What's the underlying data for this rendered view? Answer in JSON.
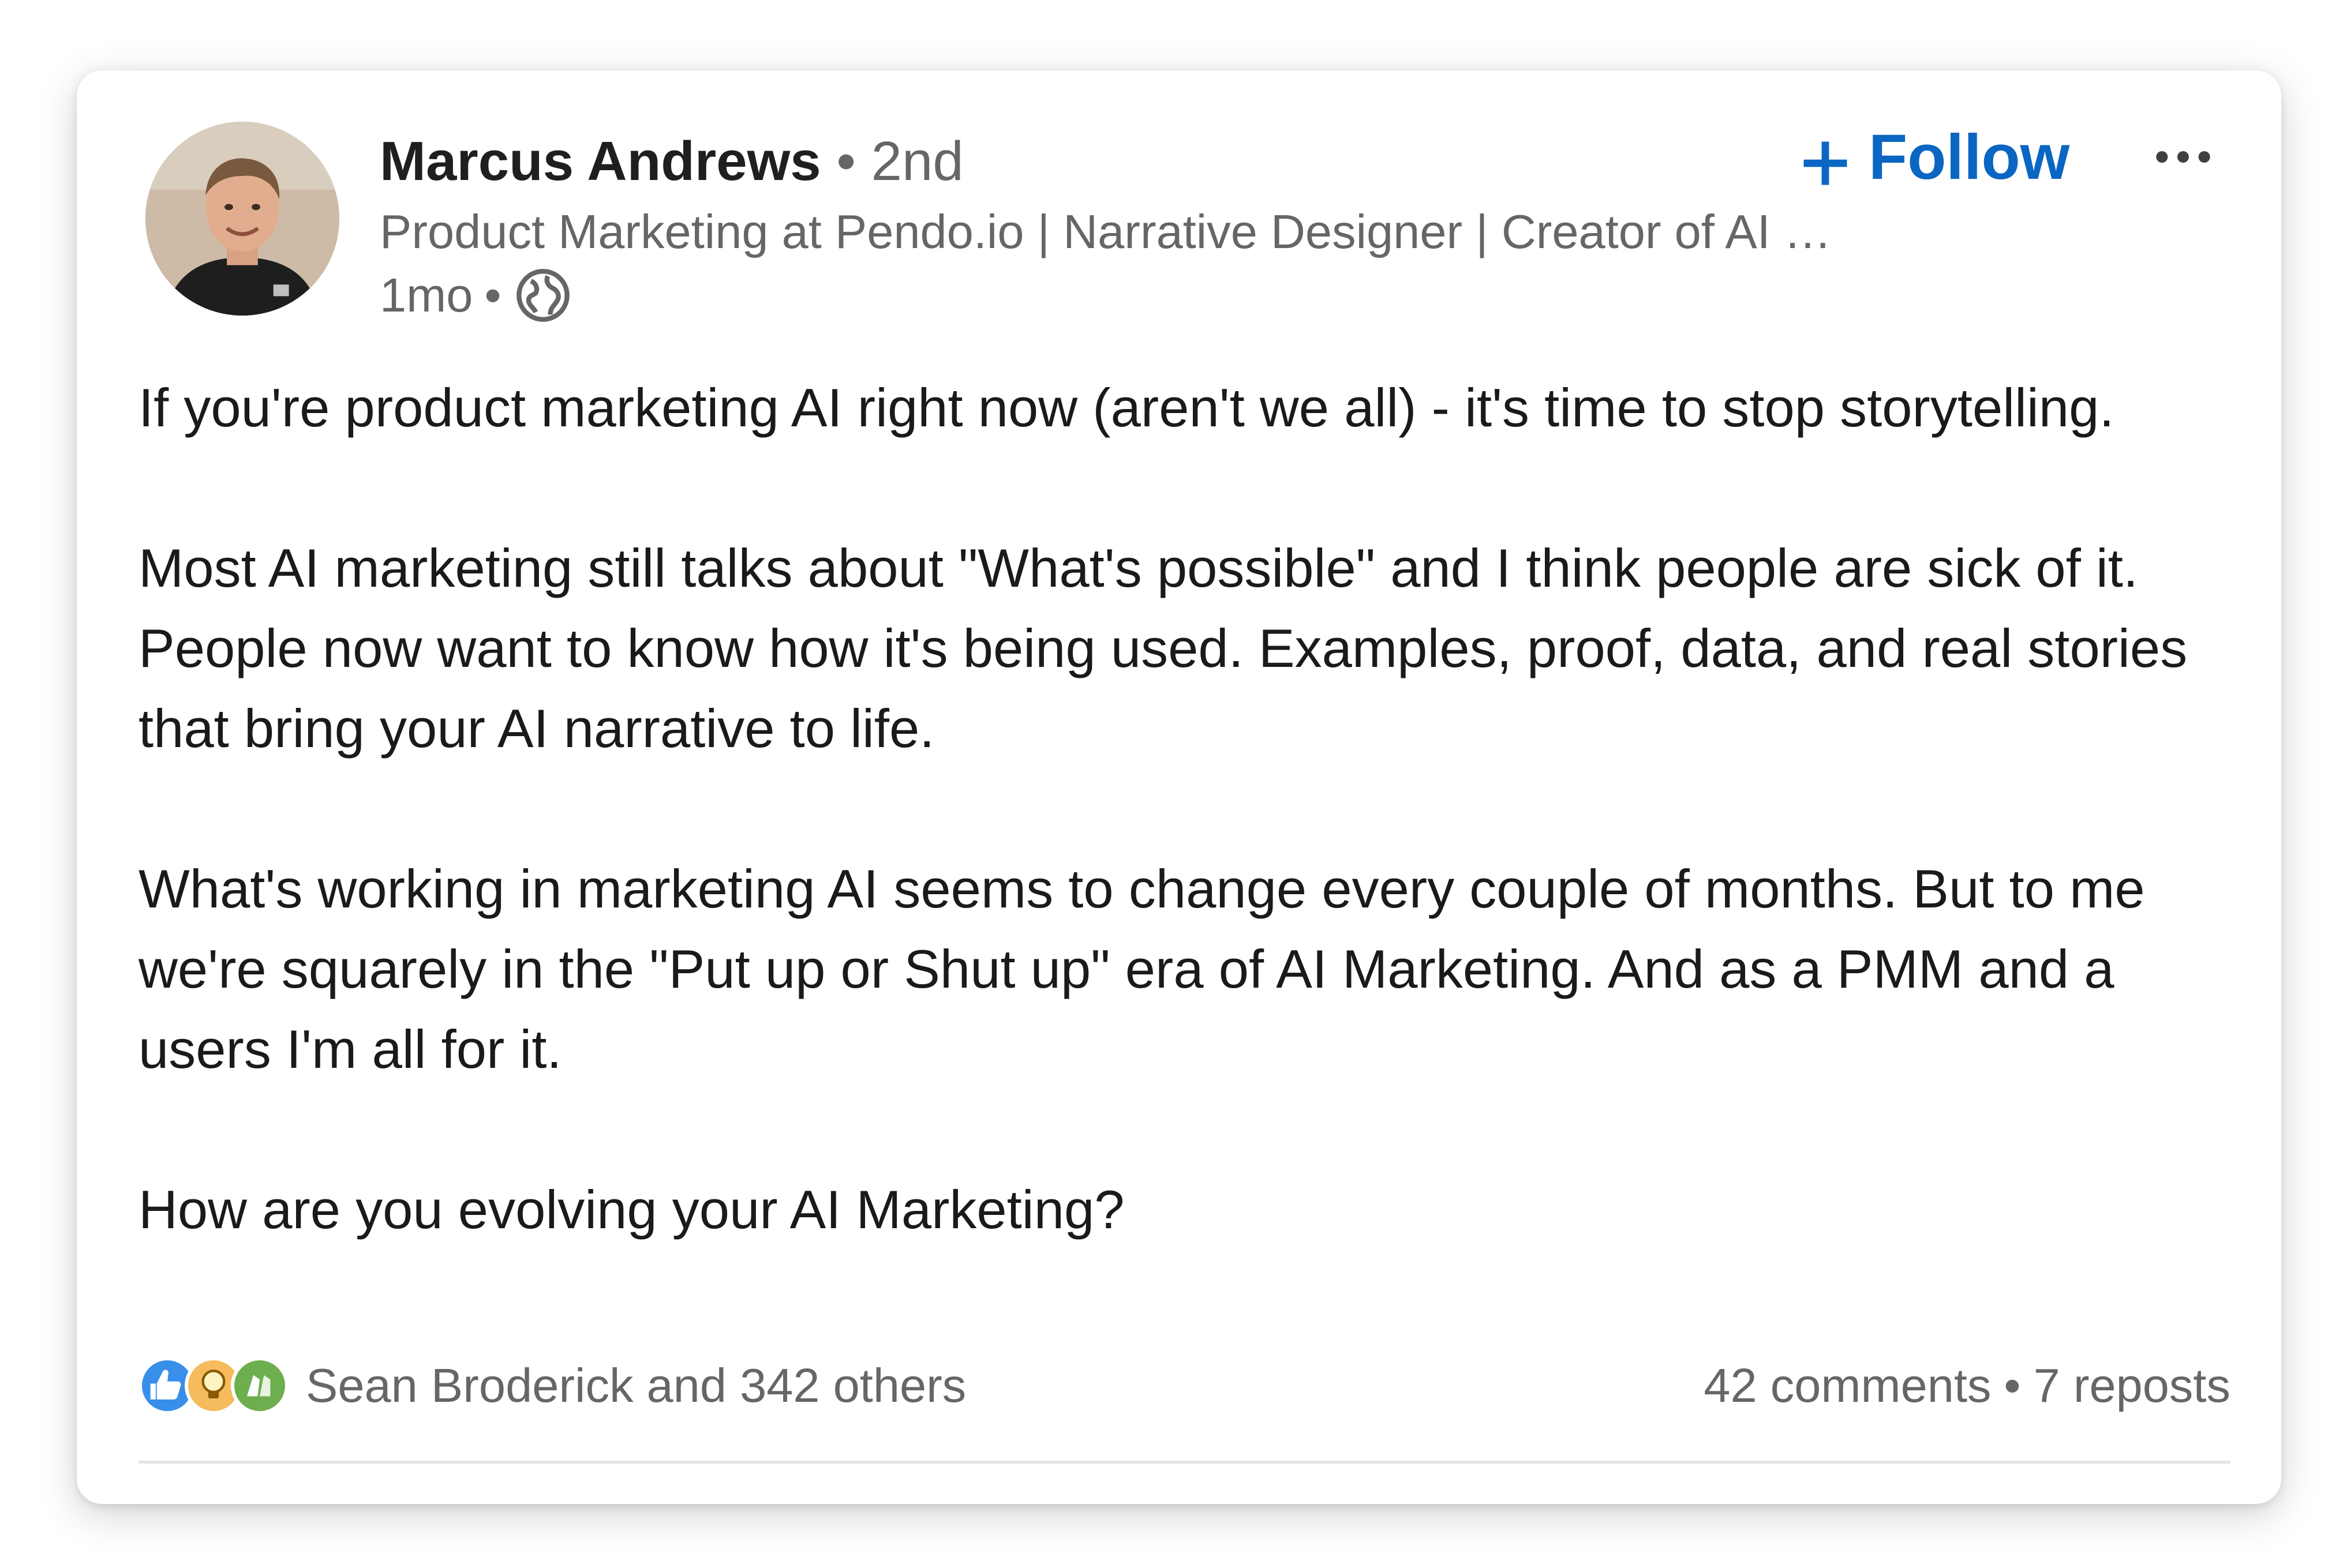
{
  "author": {
    "name": "Marcus Andrews",
    "separator": "•",
    "degree": "2nd",
    "headline": "Product Marketing at Pendo.io | Narrative Designer | Creator of AI Marketing",
    "time": "1mo",
    "time_separator": "•",
    "visibility_icon": "globe-icon"
  },
  "actions": {
    "follow_label": "Follow",
    "follow_icon": "plus-icon",
    "more_icon": "more-horizontal-icon"
  },
  "post": {
    "paragraphs": [
      "If you're product marketing AI right now (aren't we all) - it's time to stop storytelling.",
      "Most AI marketing still talks about \"What's possible\" and I think people are sick of it. People now want to know how it's being used. Examples, proof, data, and real stories that bring your AI narrative to life.",
      "What's working in marketing AI seems to change every couple of months. But to me we're squarely in the \"Put up or Shut up\" era of AI Marketing. And as a PMM and a users I'm all for it.",
      "How are you evolving your AI Marketing?"
    ]
  },
  "social": {
    "reaction_icons": [
      "like-icon",
      "insightful-icon",
      "celebrate-icon"
    ],
    "reactions_text": "Sean Broderick and 342 others",
    "comments": "42 comments",
    "separator": "•",
    "reposts": "7 reposts"
  },
  "colors": {
    "accent": "#0a66c2",
    "text": "#1a1a1a",
    "secondary": "#666666",
    "like": "#378fe9",
    "insightful": "#f5bb5c",
    "celebrate": "#6dae4f"
  }
}
